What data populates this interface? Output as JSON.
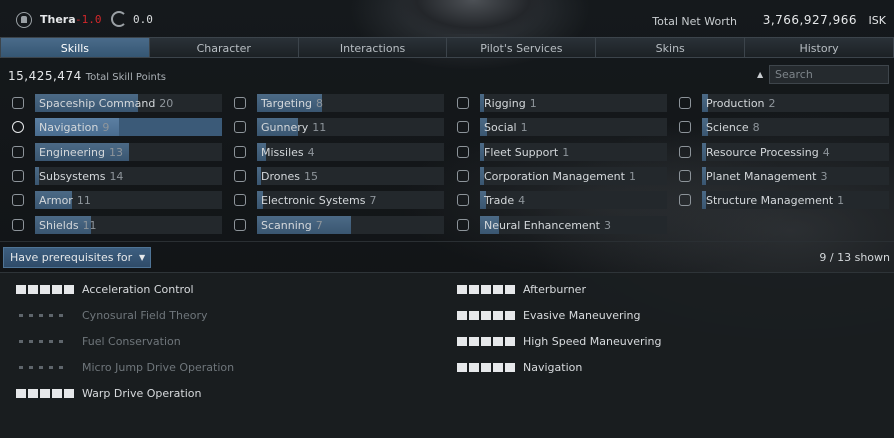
{
  "header": {
    "system_name": "Thera",
    "security_status": "-1.0",
    "clock_value": "0.0",
    "net_worth_label": "Total Net Worth",
    "net_worth_value": "3,766,927,966",
    "net_worth_currency": "ISK"
  },
  "tabs": [
    {
      "label": "Skills",
      "active": true
    },
    {
      "label": "Character",
      "active": false
    },
    {
      "label": "Interactions",
      "active": false
    },
    {
      "label": "Pilot's Services",
      "active": false
    },
    {
      "label": "Skins",
      "active": false
    },
    {
      "label": "History",
      "active": false
    }
  ],
  "summary": {
    "total_points": "15,425,474",
    "total_points_label": "Total Skill Points",
    "search_placeholder": "Search"
  },
  "groups": [
    {
      "name": "Spaceship Command",
      "count": "20",
      "fill": 0.55,
      "icon": "ship-icon"
    },
    {
      "name": "Targeting",
      "count": "8",
      "fill": 0.35,
      "icon": "crosshair-icon"
    },
    {
      "name": "Rigging",
      "count": "1",
      "fill": 0.02,
      "icon": "rigging-icon"
    },
    {
      "name": "Production",
      "count": "2",
      "fill": 0.03,
      "icon": "factory-icon"
    },
    {
      "name": "Navigation",
      "count": "9",
      "fill": 0.45,
      "icon": "helm-icon",
      "selected": true
    },
    {
      "name": "Gunnery",
      "count": "11",
      "fill": 0.22,
      "icon": "bullet-icon"
    },
    {
      "name": "Social",
      "count": "1",
      "fill": 0.04,
      "icon": "people-icon"
    },
    {
      "name": "Science",
      "count": "8",
      "fill": 0.03,
      "icon": "dna-icon"
    },
    {
      "name": "Engineering",
      "count": "13",
      "fill": 0.5,
      "icon": "atom-icon"
    },
    {
      "name": "Missiles",
      "count": "4",
      "fill": 0.05,
      "icon": "missile-icon"
    },
    {
      "name": "Fleet Support",
      "count": "1",
      "fill": 0.02,
      "icon": "fleet-icon"
    },
    {
      "name": "Resource Processing",
      "count": "4",
      "fill": 0.02,
      "icon": "recycle-icon"
    },
    {
      "name": "Subsystems",
      "count": "14",
      "fill": 0.02,
      "icon": "subsystem-icon"
    },
    {
      "name": "Drones",
      "count": "15",
      "fill": 0.02,
      "icon": "drone-icon"
    },
    {
      "name": "Corporation Management",
      "count": "1",
      "fill": 0.02,
      "icon": "corp-icon"
    },
    {
      "name": "Planet Management",
      "count": "3",
      "fill": 0.02,
      "icon": "planet-icon"
    },
    {
      "name": "Armor",
      "count": "11",
      "fill": 0.2,
      "icon": "armor-icon"
    },
    {
      "name": "Electronic Systems",
      "count": "7",
      "fill": 0.03,
      "icon": "chip-icon"
    },
    {
      "name": "Trade",
      "count": "4",
      "fill": 0.03,
      "icon": "chart-icon"
    },
    {
      "name": "Structure Management",
      "count": "1",
      "fill": 0.02,
      "icon": "structure-icon"
    },
    {
      "name": "Shields",
      "count": "11",
      "fill": 0.3,
      "icon": "shield-icon"
    },
    {
      "name": "Scanning",
      "count": "7",
      "fill": 0.5,
      "icon": "scanner-icon"
    },
    {
      "name": "Neural Enhancement",
      "count": "3",
      "fill": 0.1,
      "icon": "brain-icon"
    }
  ],
  "filter": {
    "label": "Have prerequisites for",
    "shown": "9 / 13 shown"
  },
  "skills_left": [
    {
      "name": "Acceleration Control",
      "trained": true
    },
    {
      "name": "Cynosural Field Theory",
      "trained": false
    },
    {
      "name": "Fuel Conservation",
      "trained": false
    },
    {
      "name": "Micro Jump Drive Operation",
      "trained": false
    },
    {
      "name": "Warp Drive Operation",
      "trained": true
    }
  ],
  "skills_right": [
    {
      "name": "Afterburner",
      "trained": true
    },
    {
      "name": "Evasive Maneuvering",
      "trained": true
    },
    {
      "name": "High Speed Maneuvering",
      "trained": true
    },
    {
      "name": "Navigation",
      "trained": true
    }
  ]
}
